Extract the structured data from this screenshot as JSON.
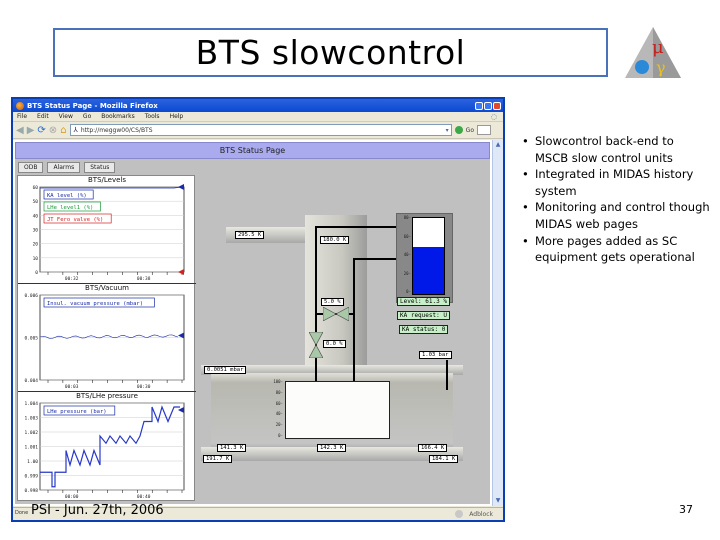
{
  "slide": {
    "title": "BTS slowcontrol",
    "footer": "PSI - Jun. 27th, 2006",
    "page_number": "37",
    "logo": "mu-e-gamma-triangle-logo",
    "bullets": [
      "Slowcontrol back-end to MSCB slow control units",
      "Integrated in MIDAS history system",
      "Monitoring and control though MIDAS web pages",
      "More pages added as SC equipment gets operational"
    ]
  },
  "browser": {
    "window_title": "BTS Status Page - Mozilla Firefox",
    "menu": [
      "File",
      "Edit",
      "View",
      "Go",
      "Bookmarks",
      "Tools",
      "Help"
    ],
    "url": "http://meggw00/CS/BTS",
    "go_label": "Go",
    "status_text": "Done",
    "adblock_label": "Adblock",
    "nav_icons": [
      "back-icon",
      "forward-icon",
      "reload-icon",
      "stop-icon",
      "home-icon"
    ]
  },
  "page": {
    "header": "BTS Status Page",
    "tabs": [
      "ODB",
      "Alarms",
      "Status"
    ]
  },
  "plots": [
    {
      "title": "BTS/Levels",
      "y_ticks": [
        "60",
        "50",
        "40",
        "30",
        "20",
        "10",
        "0"
      ],
      "x_ticks": [
        "00:32",
        "00:38"
      ],
      "legend": [
        {
          "label": "KA level (%)",
          "color": "#1a2aa8"
        },
        {
          "label": "LHe level1 (%)",
          "color": "#1a9a3a"
        },
        {
          "label": "JT Fero valve (%)",
          "color": "#d42020"
        }
      ]
    },
    {
      "title": "BTS/Vacuum",
      "y_ticks": [
        "0.006",
        "0.005",
        "0.004"
      ],
      "x_ticks": [
        "00:03",
        "00:30"
      ],
      "legend": [
        {
          "label": "Insul. vacuum pressure (mbar)",
          "color": "#1a2aa8"
        }
      ]
    },
    {
      "title": "BTS/LHe pressure",
      "y_ticks": [
        "1.004",
        "1.003",
        "1.002",
        "1.001",
        "1.00",
        "0.999",
        "0.998"
      ],
      "x_ticks": [
        "00:00",
        "00:40"
      ],
      "legend": [
        {
          "label": "LHe pressure (bar)",
          "color": "#1a2aa8"
        }
      ]
    }
  ],
  "synoptic": {
    "readouts": {
      "temp_left": "295.5 K",
      "temp_top": "180.0 K",
      "valve1": "5.0 %",
      "valve2": "0.0 %",
      "pressure_right": "1.03 bar",
      "vacuum": "0.0051 mbar",
      "t_bl": "141.3 K",
      "t_bm": "142.3 K",
      "t_br": "166.4 K",
      "t_bottom_left": "191.7 K",
      "t_bottom_right": "184.1 K"
    },
    "tank": {
      "level_label": "Level: 61.3 %",
      "level_percent": 61.3,
      "ticks": [
        "80",
        "60",
        "40",
        "20",
        "0"
      ]
    },
    "ka_request": "KA request: U",
    "ka_status": "KA status: 0",
    "lower_plot_ticks": [
      "100",
      "80",
      "60",
      "40",
      "20",
      "0"
    ]
  },
  "colors": {
    "title_border": "#4a72b8",
    "tank_fill": "#0018e8",
    "page_header_bg": "#aaaaee",
    "green_box": "#c8f0c8"
  }
}
